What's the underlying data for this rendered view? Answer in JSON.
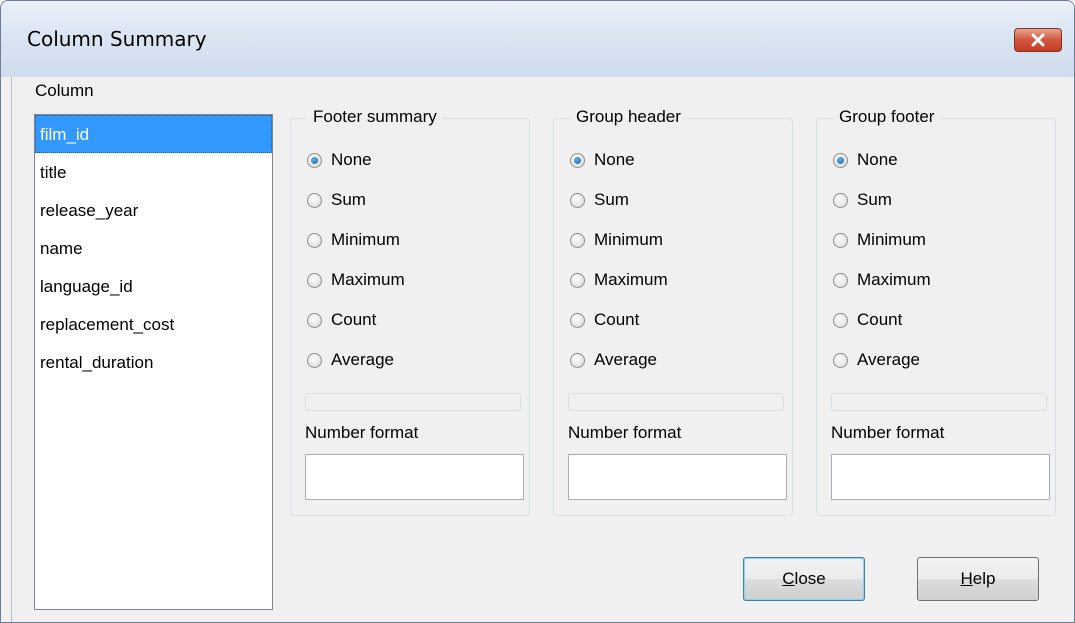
{
  "window": {
    "title": "Column Summary"
  },
  "column_label": "Column",
  "columns": [
    {
      "label": "film_id",
      "selected": true
    },
    {
      "label": "title",
      "selected": false
    },
    {
      "label": "release_year",
      "selected": false
    },
    {
      "label": "name",
      "selected": false
    },
    {
      "label": "language_id",
      "selected": false
    },
    {
      "label": "replacement_cost",
      "selected": false
    },
    {
      "label": "rental_duration",
      "selected": false
    }
  ],
  "groups": [
    {
      "title": "Footer summary",
      "options": [
        "None",
        "Sum",
        "Minimum",
        "Maximum",
        "Count",
        "Average"
      ],
      "selected": "None",
      "number_format_label": "Number format",
      "number_format_value": ""
    },
    {
      "title": "Group header",
      "options": [
        "None",
        "Sum",
        "Minimum",
        "Maximum",
        "Count",
        "Average"
      ],
      "selected": "None",
      "number_format_label": "Number format",
      "number_format_value": ""
    },
    {
      "title": "Group footer",
      "options": [
        "None",
        "Sum",
        "Minimum",
        "Maximum",
        "Count",
        "Average"
      ],
      "selected": "None",
      "number_format_label": "Number format",
      "number_format_value": ""
    }
  ],
  "buttons": {
    "close": {
      "mnemonic": "C",
      "rest": "lose"
    },
    "help": {
      "mnemonic": "H",
      "rest": "elp"
    }
  },
  "colors": {
    "selection": "#3399ff",
    "close_button": "#c43c22"
  }
}
